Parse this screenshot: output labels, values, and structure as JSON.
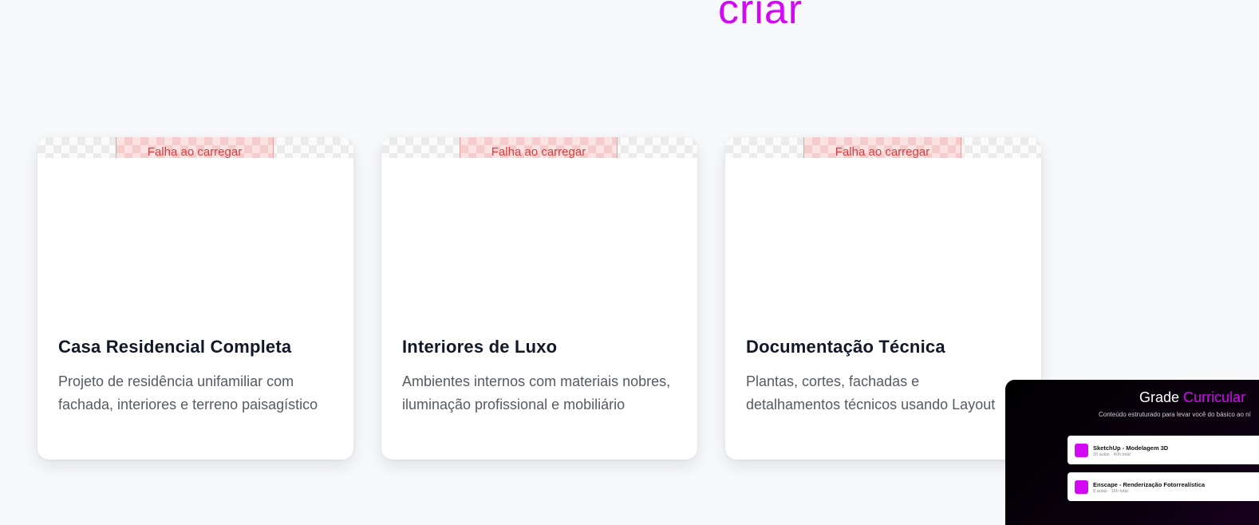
{
  "hero": {
    "heading_fragment": "criar"
  },
  "colors": {
    "accent": "#d209f2",
    "card_background": "#ffffff",
    "page_background": "#f8f9fb",
    "error_text": "#d64040"
  },
  "projects": [
    {
      "image_status": "Falha ao carregar",
      "title": "Casa Residencial Completa",
      "description": "Projeto de residência unifamiliar com fachada, interiores e terreno paisagístico"
    },
    {
      "image_status": "Falha ao carregar",
      "title": "Interiores de Luxo",
      "description": "Ambientes internos com materiais nobres, iluminação profissional e mobiliário"
    },
    {
      "image_status": "Falha ao carregar",
      "title": "Documentação Técnica",
      "description": "Plantas, cortes, fachadas e detalhamentos técnicos usando Layout"
    }
  ],
  "curriculum": {
    "title_part1": "Grade",
    "title_part2": "Curricular",
    "subtitle": "Conteúdo estruturado para levar você do básico ao ní",
    "modules": [
      {
        "icon": "module-square-icon",
        "title": "SketchUp - Modelagem 3D",
        "meta": "20 aulas · 40h total"
      },
      {
        "icon": "module-square-icon",
        "title": "Enscape - Renderização Fotorrealística",
        "meta": "8 aulas · 16h total"
      }
    ]
  }
}
